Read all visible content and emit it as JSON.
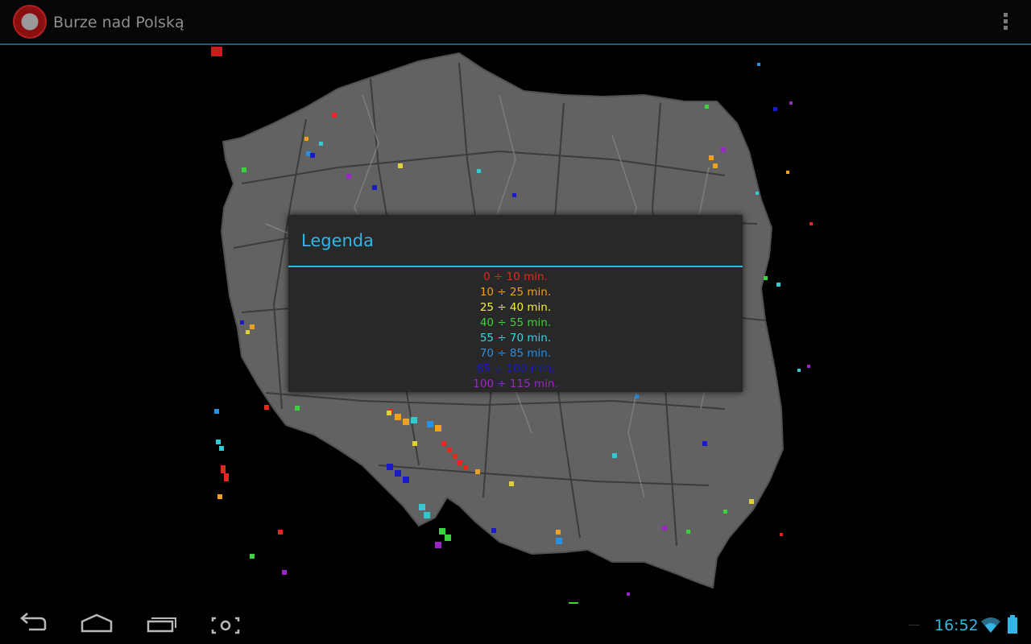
{
  "app": {
    "title": "Burze nad Polską",
    "icon": "storm-logo-icon"
  },
  "action_bar": {
    "overflow_icon": "overflow-menu-icon"
  },
  "dialog": {
    "title": "Legenda",
    "items": [
      {
        "label": "0 ÷ 10 min.",
        "color": "#e8251f"
      },
      {
        "label": "10 ÷ 25 min.",
        "color": "#f0a01c"
      },
      {
        "label": "25 ÷ 40 min.",
        "color": "#f5f03a"
      },
      {
        "label": "40 ÷ 55 min.",
        "color": "#3bd33b"
      },
      {
        "label": "55 ÷ 70 min.",
        "color": "#34d8e0"
      },
      {
        "label": "70 ÷ 85 min.",
        "color": "#2a8fe0"
      },
      {
        "label": "85 ÷ 100 min.",
        "color": "#1a1aca"
      },
      {
        "label": "100 ÷ 115 min.",
        "color": "#9a26c8"
      }
    ]
  },
  "colors": {
    "accent": "#33b5e5",
    "map_fill": "#606060",
    "dialog_bg": "#282828"
  },
  "nav": {
    "back_icon": "back-icon",
    "home_icon": "home-icon",
    "recents_icon": "recent-apps-icon",
    "screenshot_icon": "screenshot-icon"
  },
  "status": {
    "time": "16:52",
    "wifi_icon": "wifi-icon",
    "battery_icon": "battery-icon"
  }
}
